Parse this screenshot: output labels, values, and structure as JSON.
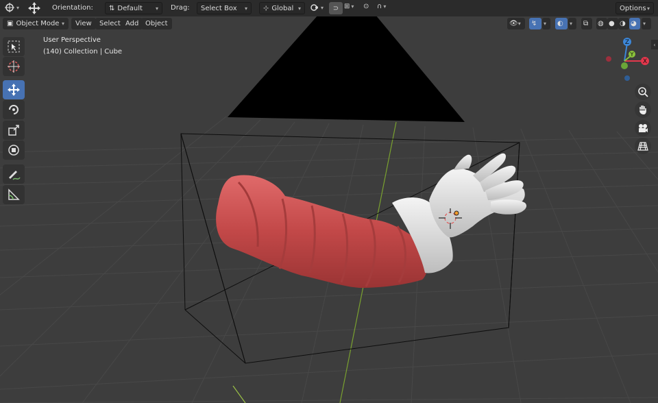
{
  "header": {
    "orientation_label": "Orientation:",
    "orientation_value": "Default",
    "drag_label": "Drag:",
    "drag_value": "Select Box",
    "transform_space": "Global",
    "options_label": "Options"
  },
  "viewport_header": {
    "mode": "Object Mode",
    "menus": [
      "View",
      "Select",
      "Add",
      "Object"
    ]
  },
  "overlay": {
    "view_name": "User Perspective",
    "collection_info": "(140) Collection | Cube"
  },
  "gizmo": {
    "axis_z": "Z",
    "axis_y": "Y",
    "axis_x": "X",
    "colors": {
      "x": "#e3374c",
      "y": "#8bc33b",
      "z": "#3c87d9"
    }
  },
  "tools": [
    "select-box",
    "cursor",
    "move",
    "rotate",
    "scale",
    "transform",
    "annotate",
    "measure"
  ],
  "active_tool": "move",
  "colors": {
    "accent": "#4772b3",
    "header_bg": "#2b2b2b",
    "viewport_bg": "#3d3d3d",
    "grid_line": "#474747",
    "y_axis_line": "#7aa22f",
    "sleeve": "#c94e4e",
    "glove": "#e6e6e6"
  }
}
